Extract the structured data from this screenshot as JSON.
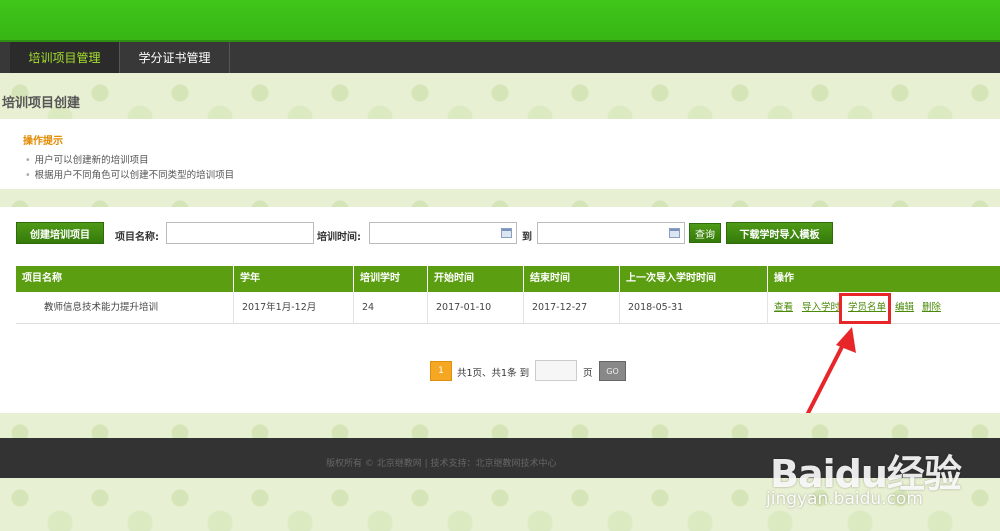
{
  "nav": {
    "tabs": [
      {
        "label": "培训项目管理",
        "active": true
      },
      {
        "label": "学分证书管理",
        "active": false
      }
    ]
  },
  "page": {
    "title": "培训项目创建"
  },
  "tips": {
    "title": "操作提示",
    "items": [
      "用户可以创建新的培训项目",
      "根据用户不同角色可以创建不同类型的培训项目"
    ]
  },
  "toolbar": {
    "create_label": "创建培训项目",
    "name_label": "项目名称:",
    "name_value": "",
    "time_label": "培训时间:",
    "start_value": "",
    "to_label": "到",
    "end_value": "",
    "query_label": "查询",
    "download_label": "下载学时导入模板"
  },
  "table": {
    "headers": [
      "项目名称",
      "学年",
      "培训学时",
      "开始时间",
      "结束时间",
      "上一次导入学时时间",
      "操作"
    ],
    "rows": [
      {
        "name": "教师信息技术能力提升培训",
        "year": "2017年1月-12月",
        "hours": "24",
        "start": "2017-01-10",
        "end": "2017-12-27",
        "last_import": "2018-05-31",
        "ops": [
          "查看",
          "导入学时",
          "学员名单",
          "编辑",
          "删除"
        ]
      }
    ]
  },
  "pager": {
    "current": "1",
    "summary": "共1页、共1条 到",
    "page_suffix": "页",
    "go_label": "GO",
    "goto_value": ""
  },
  "footer": {
    "text": "版权所有 © 北京继教网 | 技术支持：北京继教网技术中心"
  },
  "watermark": {
    "logo": "Baidu经验",
    "url": "jingyan.baidu.com"
  },
  "colors": {
    "brand_green": "#3fc61a",
    "header_green": "#5c9e12",
    "highlight_red": "#e8262a",
    "pager_orange": "#f5a623"
  }
}
